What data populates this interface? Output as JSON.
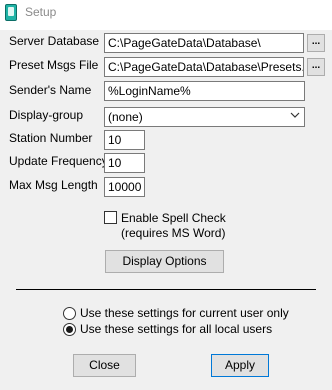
{
  "window": {
    "title": "Setup",
    "icon": "pager-app-icon"
  },
  "fields": {
    "server_database": {
      "label": "Server Database",
      "value": "C:\\PageGateData\\Database\\"
    },
    "preset_msgs_file": {
      "label": "Preset Msgs File",
      "value": "C:\\PageGateData\\Database\\Presets.txt"
    },
    "senders_name": {
      "label": "Sender's Name",
      "value": "%LoginName%"
    },
    "display_group": {
      "label": "Display-group",
      "value": "(none)"
    },
    "station_number": {
      "label": "Station Number",
      "value": "10"
    },
    "update_frequency": {
      "label": "Update Frequency",
      "value": "10"
    },
    "max_msg_length": {
      "label": "Max Msg Length",
      "value": "10000"
    }
  },
  "browse_label": "...",
  "spell_check": {
    "label_line1": "Enable Spell Check",
    "label_line2": "(requires MS Word)",
    "checked": false
  },
  "buttons": {
    "display_options": "Display Options",
    "close": "Close",
    "apply": "Apply"
  },
  "scope": {
    "current_user": {
      "label": "Use these settings for current user only",
      "selected": false
    },
    "all_users": {
      "label": "Use these settings for all local users",
      "selected": true
    }
  }
}
